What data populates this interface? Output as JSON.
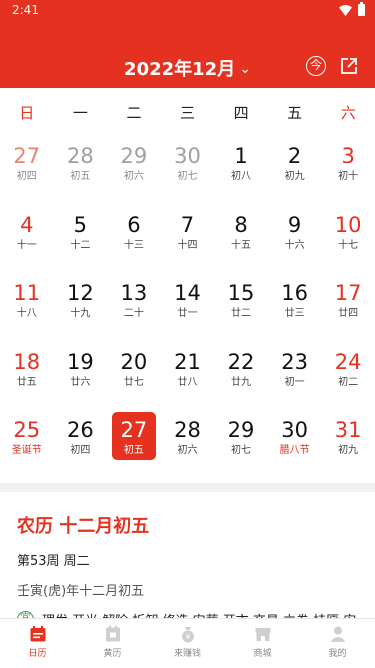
{
  "status_bar": {
    "time": "2:41"
  },
  "header": {
    "month_title": "2022年12月",
    "today_button": "今"
  },
  "weekdays": [
    "日",
    "一",
    "二",
    "三",
    "四",
    "五",
    "六"
  ],
  "calendar": {
    "weeks": [
      [
        {
          "day": "27",
          "lunar": "初四",
          "prev": true
        },
        {
          "day": "28",
          "lunar": "初五",
          "prev": true
        },
        {
          "day": "29",
          "lunar": "初六",
          "prev": true
        },
        {
          "day": "30",
          "lunar": "初七",
          "prev": true
        },
        {
          "day": "1",
          "lunar": "初八"
        },
        {
          "day": "2",
          "lunar": "初九"
        },
        {
          "day": "3",
          "lunar": "初十"
        }
      ],
      [
        {
          "day": "4",
          "lunar": "十一"
        },
        {
          "day": "5",
          "lunar": "十二"
        },
        {
          "day": "6",
          "lunar": "十三"
        },
        {
          "day": "7",
          "lunar": "十四"
        },
        {
          "day": "8",
          "lunar": "十五"
        },
        {
          "day": "9",
          "lunar": "十六"
        },
        {
          "day": "10",
          "lunar": "十七"
        }
      ],
      [
        {
          "day": "11",
          "lunar": "十八"
        },
        {
          "day": "12",
          "lunar": "十九"
        },
        {
          "day": "13",
          "lunar": "二十"
        },
        {
          "day": "14",
          "lunar": "廿一"
        },
        {
          "day": "15",
          "lunar": "廿二"
        },
        {
          "day": "16",
          "lunar": "廿三"
        },
        {
          "day": "17",
          "lunar": "廿四"
        }
      ],
      [
        {
          "day": "18",
          "lunar": "廿五"
        },
        {
          "day": "19",
          "lunar": "廿六"
        },
        {
          "day": "20",
          "lunar": "廿七"
        },
        {
          "day": "21",
          "lunar": "廿八"
        },
        {
          "day": "22",
          "lunar": "廿九"
        },
        {
          "day": "23",
          "lunar": "初一"
        },
        {
          "day": "24",
          "lunar": "初二"
        }
      ],
      [
        {
          "day": "25",
          "lunar": "圣诞节",
          "festival": true
        },
        {
          "day": "26",
          "lunar": "初四"
        },
        {
          "day": "27",
          "lunar": "初五",
          "selected": true
        },
        {
          "day": "28",
          "lunar": "初六"
        },
        {
          "day": "29",
          "lunar": "初七"
        },
        {
          "day": "30",
          "lunar": "腊八节",
          "festival": true
        },
        {
          "day": "31",
          "lunar": "初九"
        }
      ]
    ]
  },
  "detail": {
    "lunar_title": "农历 十二月初五",
    "week_info": "第53周 周二",
    "ganzhi": "壬寅(虎)年十二月初五",
    "yi_badge": "宜",
    "yi_text": "理发 开光 解除 拆卸 修造 安葬 开市 交易 立券 挂匾 安"
  },
  "tabbar": [
    {
      "label": "日历",
      "icon": "calendar-icon",
      "active": true
    },
    {
      "label": "黄历",
      "icon": "almanac-icon"
    },
    {
      "label": "来赚钱",
      "icon": "money-bag-icon"
    },
    {
      "label": "商城",
      "icon": "store-icon"
    },
    {
      "label": "我的",
      "icon": "user-icon"
    }
  ],
  "colors": {
    "accent": "#e5311f",
    "yi_green": "#2e9d52"
  }
}
